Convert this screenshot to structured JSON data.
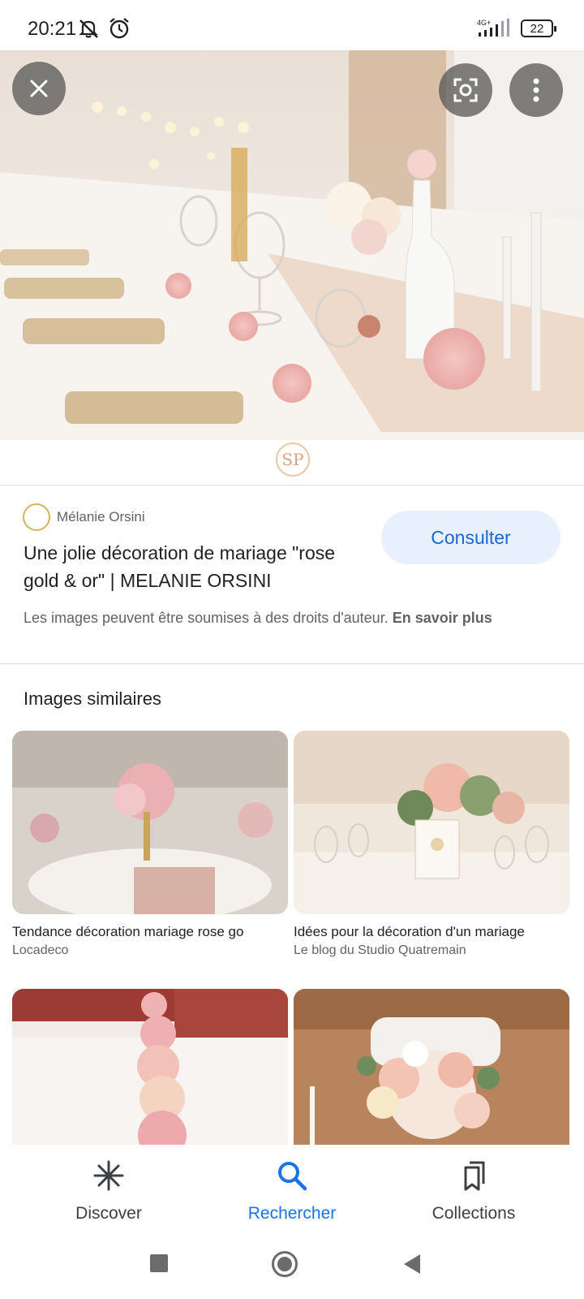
{
  "status_bar": {
    "time": "20:21",
    "network": "4G+",
    "battery": "22",
    "icons": [
      "mute-icon",
      "alarm-icon",
      "signal-icon",
      "battery-icon"
    ]
  },
  "hero": {
    "watermark_logo": "SP"
  },
  "result": {
    "source": "Mélanie Orsini",
    "title": "Une jolie décoration de mariage \"rose gold & or\" | MELANIE ORSINI",
    "consult_label": "Consulter",
    "copyright_text": "Les images peuvent être soumises à des droits d'auteur.",
    "learn_more": "En savoir plus"
  },
  "similar": {
    "heading": "Images similaires",
    "items": [
      {
        "title": "Tendance décoration mariage rose go",
        "source": "Locadeco"
      },
      {
        "title": "Idées pour la décoration d'un mariage",
        "source": "Le blog du Studio Quatremain"
      },
      {
        "title": "",
        "source": ""
      },
      {
        "title": "",
        "source": ""
      }
    ]
  },
  "bottom_nav": {
    "items": [
      {
        "label": "Discover",
        "icon": "asterisk-icon"
      },
      {
        "label": "Rechercher",
        "icon": "search-icon",
        "active": true
      },
      {
        "label": "Collections",
        "icon": "bookmarks-icon"
      }
    ]
  },
  "colors": {
    "accent": "#1a73e8",
    "consult_bg": "#e8f0fe",
    "consult_text": "#1967d2"
  }
}
